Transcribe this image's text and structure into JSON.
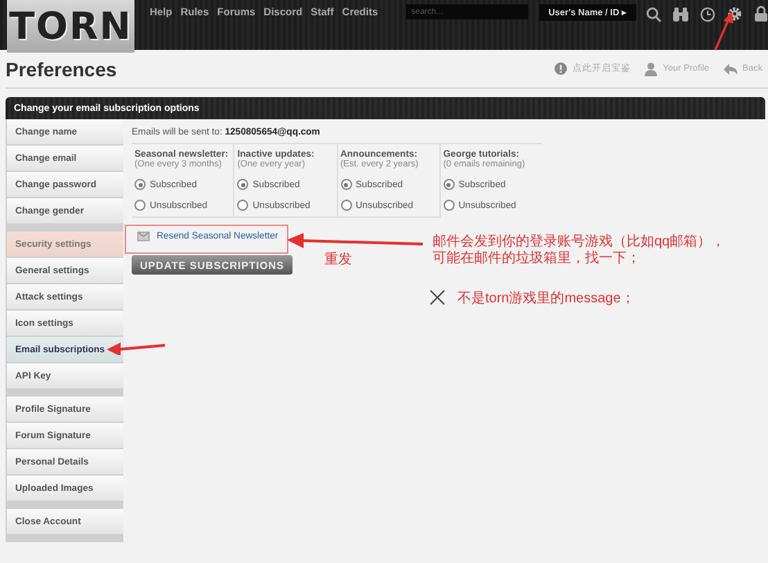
{
  "header": {
    "logo": "TORN",
    "nav": [
      "Help",
      "Rules",
      "Forums",
      "Discord",
      "Staff",
      "Credits"
    ],
    "search": {
      "placeholder": "search..."
    },
    "user_button": "User's Name / ID ▸"
  },
  "page": {
    "title": "Preferences",
    "links": [
      {
        "kind": "alert",
        "label": "点此开启宝鉴"
      },
      {
        "kind": "profile",
        "label": "Your Profile"
      },
      {
        "kind": "back",
        "label": "Back"
      }
    ]
  },
  "section_title": "Change your email subscription options",
  "sidebar": {
    "groups": [
      {
        "items": [
          {
            "label": "Change name",
            "selected": false,
            "hovered": false
          },
          {
            "label": "Change email",
            "selected": false,
            "hovered": false
          },
          {
            "label": "Change password",
            "selected": false,
            "hovered": false
          },
          {
            "label": "Change gender",
            "selected": false,
            "hovered": false
          }
        ]
      },
      {
        "items": [
          {
            "label": "Security settings",
            "selected": false,
            "hovered": true
          },
          {
            "label": "General settings",
            "selected": false,
            "hovered": false
          },
          {
            "label": "Attack settings",
            "selected": false,
            "hovered": false
          },
          {
            "label": "Icon settings",
            "selected": false,
            "hovered": false
          },
          {
            "label": "Email subscriptions",
            "selected": true,
            "hovered": false
          },
          {
            "label": "API Key",
            "selected": false,
            "hovered": false
          }
        ]
      },
      {
        "items": [
          {
            "label": "Profile Signature",
            "selected": false,
            "hovered": false
          },
          {
            "label": "Forum Signature",
            "selected": false,
            "hovered": false
          },
          {
            "label": "Personal Details",
            "selected": false,
            "hovered": false
          },
          {
            "label": "Uploaded Images",
            "selected": false,
            "hovered": false
          }
        ]
      },
      {
        "items": [
          {
            "label": "Close Account",
            "selected": false,
            "hovered": false
          }
        ]
      }
    ]
  },
  "email_line": {
    "label": "Emails will be sent to:",
    "value": "1250805654@qq.com"
  },
  "columns": [
    {
      "title": "Seasonal newsletter:",
      "subtitle": "(One every 3 months)",
      "options": [
        {
          "label": "Subscribed",
          "selected": true
        },
        {
          "label": "Unsubscribed",
          "selected": false
        }
      ]
    },
    {
      "title": "Inactive updates:",
      "subtitle": "(One every year)",
      "options": [
        {
          "label": "Subscribed",
          "selected": true
        },
        {
          "label": "Unsubscribed",
          "selected": false
        }
      ]
    },
    {
      "title": "Announcements:",
      "subtitle": "(Est. every 2 years)",
      "options": [
        {
          "label": "Subscribed",
          "selected": true
        },
        {
          "label": "Unsubscribed",
          "selected": false
        }
      ]
    },
    {
      "title": "George tutorials:",
      "subtitle": "(0 emails remaining)",
      "options": [
        {
          "label": "Subscribed",
          "selected": true
        },
        {
          "label": "Unsubscribed",
          "selected": false
        }
      ]
    }
  ],
  "resend_link": "Resend Seasonal Newsletter",
  "update_button": "UPDATE SUBSCRIPTIONS",
  "annotations": {
    "resend_label": "重发",
    "note_lines": [
      "邮件会发到你的登录账号游戏（比如qq邮箱），",
      "可能在邮件的垃圾箱里，找一下；"
    ],
    "warning": "不是torn游戏里的message；"
  }
}
